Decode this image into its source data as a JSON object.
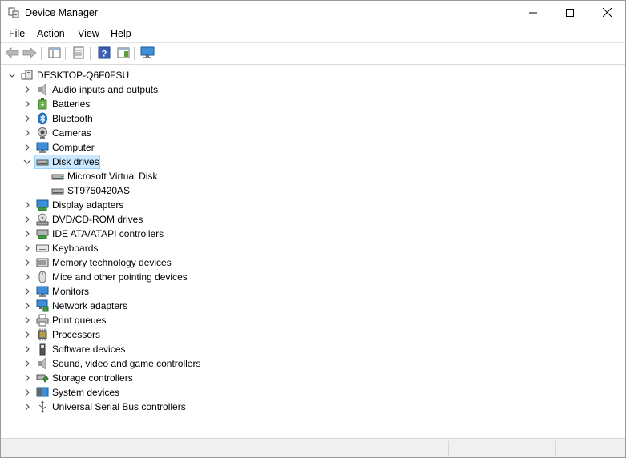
{
  "window": {
    "title": "Device Manager",
    "controls": {
      "minimize": "minimize-icon",
      "maximize": "maximize-icon",
      "close": "close-icon"
    }
  },
  "menu": {
    "items": [
      {
        "label": "File",
        "accel": "F",
        "rest": "ile"
      },
      {
        "label": "Action",
        "accel": "A",
        "rest": "ction"
      },
      {
        "label": "View",
        "accel": "V",
        "rest": "iew"
      },
      {
        "label": "Help",
        "accel": "H",
        "rest": "elp"
      }
    ]
  },
  "toolbar": {
    "buttons": [
      "back-arrow-icon",
      "forward-arrow-icon",
      "show-hide-console-tree-icon",
      "properties-icon",
      "help-icon",
      "action-pane-icon",
      "monitor-icon"
    ]
  },
  "tree": {
    "root": {
      "label": "DESKTOP-Q6F0FSU",
      "expanded": true
    },
    "categories": [
      {
        "label": "Audio inputs and outputs",
        "icon": "speaker-icon",
        "expanded": false
      },
      {
        "label": "Batteries",
        "icon": "battery-icon",
        "expanded": false
      },
      {
        "label": "Bluetooth",
        "icon": "bluetooth-icon",
        "expanded": false
      },
      {
        "label": "Cameras",
        "icon": "camera-icon",
        "expanded": false
      },
      {
        "label": "Computer",
        "icon": "computer-icon",
        "expanded": false
      },
      {
        "label": "Disk drives",
        "icon": "disk-drive-icon",
        "expanded": true,
        "selected": true,
        "children": [
          {
            "label": "Microsoft Virtual Disk",
            "icon": "disk-drive-icon"
          },
          {
            "label": "ST9750420AS",
            "icon": "disk-drive-icon"
          }
        ]
      },
      {
        "label": "Display adapters",
        "icon": "display-adapter-icon",
        "expanded": false
      },
      {
        "label": "DVD/CD-ROM drives",
        "icon": "dvd-drive-icon",
        "expanded": false
      },
      {
        "label": "IDE ATA/ATAPI controllers",
        "icon": "ide-controller-icon",
        "expanded": false
      },
      {
        "label": "Keyboards",
        "icon": "keyboard-icon",
        "expanded": false
      },
      {
        "label": "Memory technology devices",
        "icon": "memory-icon",
        "expanded": false
      },
      {
        "label": "Mice and other pointing devices",
        "icon": "mouse-icon",
        "expanded": false
      },
      {
        "label": "Monitors",
        "icon": "monitor-icon",
        "expanded": false
      },
      {
        "label": "Network adapters",
        "icon": "network-adapter-icon",
        "expanded": false
      },
      {
        "label": "Print queues",
        "icon": "printer-icon",
        "expanded": false
      },
      {
        "label": "Processors",
        "icon": "processor-icon",
        "expanded": false
      },
      {
        "label": "Software devices",
        "icon": "software-device-icon",
        "expanded": false
      },
      {
        "label": "Sound, video and game controllers",
        "icon": "speaker-icon",
        "expanded": false
      },
      {
        "label": "Storage controllers",
        "icon": "storage-controller-icon",
        "expanded": false
      },
      {
        "label": "System devices",
        "icon": "system-devices-icon",
        "expanded": false
      },
      {
        "label": "Universal Serial Bus controllers",
        "icon": "usb-icon",
        "expanded": false
      }
    ]
  },
  "colors": {
    "selection": "#cce8ff",
    "selection_border": "#99d1ff",
    "accent_blue": "#1e73be"
  }
}
